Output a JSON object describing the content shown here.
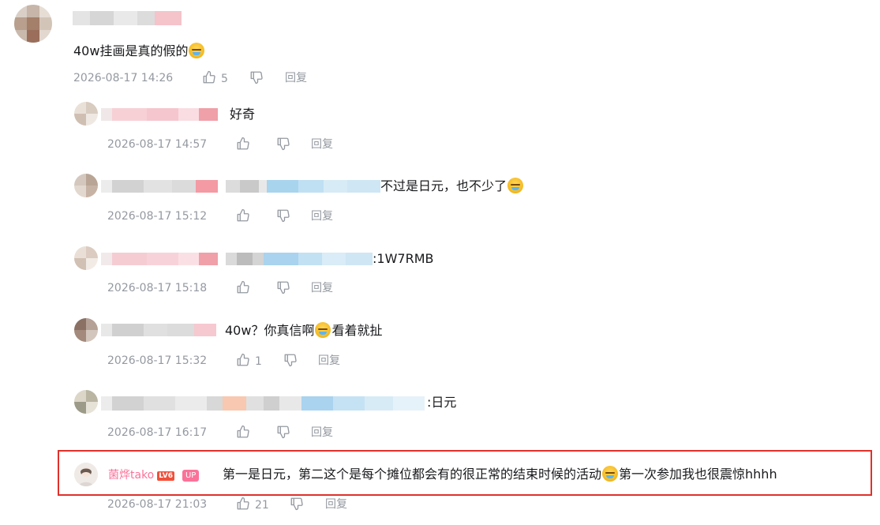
{
  "main_comment": {
    "text": "40w挂画是真的假的",
    "time": "2026-08-17 14:26",
    "likes": "5",
    "reply_label": "回复"
  },
  "replies": [
    {
      "text": "好奇",
      "time": "2026-08-17 14:57",
      "likes": "",
      "reply_label": "回复"
    },
    {
      "text": "不过是日元，也不少了",
      "time": "2026-08-17 15:12",
      "likes": "",
      "reply_label": "回复"
    },
    {
      "text": ":1W7RMB",
      "time": "2026-08-17 15:18",
      "likes": "",
      "reply_label": "回复"
    },
    {
      "text_a": "40w？你真信啊",
      "text_b": "看着就扯",
      "time": "2026-08-17 15:32",
      "likes": "1",
      "reply_label": "回复"
    },
    {
      "text": ":日元",
      "time": "2026-08-17 16:17",
      "likes": "",
      "reply_label": "回复"
    }
  ],
  "uploader_reply": {
    "username": "菌烨tako",
    "level": "LV6",
    "up_badge": "UP",
    "text_a": "第一是日元，第二这个是每个摊位都会有的很正常的结束时候的活动",
    "text_b": "第一次参加我也很震惊hhhh",
    "time": "2026-08-17 21:03",
    "likes": "21",
    "reply_label": "回复"
  },
  "colors": {
    "highlight": "#e0302a",
    "up_pink": "#fb7299",
    "meta_gray": "#9499a0"
  },
  "icons": {
    "like": "thumbs-up-icon",
    "dislike": "thumbs-down-icon",
    "emoji": "laughing-crying-emoji-icon"
  }
}
